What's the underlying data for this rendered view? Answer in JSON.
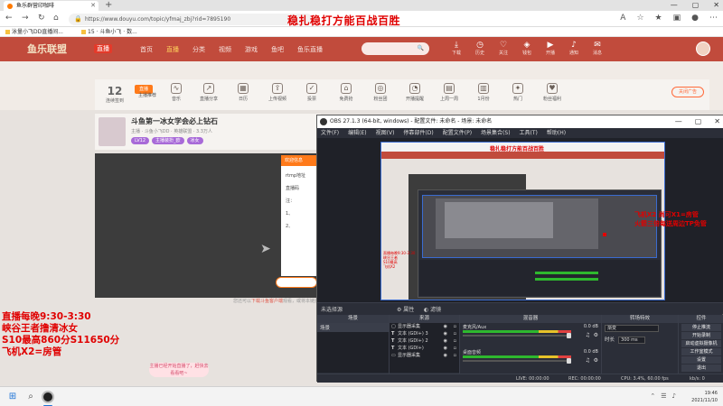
{
  "browser": {
    "tab_title": "鱼乐群营印咖啡",
    "new_tab": "+",
    "window_controls": [
      "—",
      "▢",
      "✕"
    ],
    "url": "https://www.douyu.com/topic/yfmaj_zbj?rid=7895190",
    "bookmarks": [
      "泳量小飞DD直播间...",
      "15 · 斗鱼小飞 · 数..."
    ]
  },
  "overlay_title": "稳扎稳打方能百战百胜",
  "site": {
    "logo": "鱼乐联盟",
    "logo_badge": "直播",
    "nav": [
      "首页",
      "直播",
      "分类",
      "视频",
      "游戏",
      "鱼吧",
      "鱼乐直播"
    ],
    "nav_active_index": 1,
    "header_icons": [
      "下载",
      "历史",
      "关注",
      "钱包",
      "开播",
      "通知",
      "消息"
    ],
    "func_date_num": "12",
    "func_date_label": "连续签到",
    "func_tag": "直播",
    "func_items": [
      "主播推荐",
      "音乐",
      "直播分享",
      "日历",
      "上传视频",
      "投票",
      "免费抢",
      "粉丝团",
      "开播提醒",
      "上周一周",
      "1月份",
      "热门",
      "粉丝福利"
    ],
    "func_right": "关闭广告",
    "room_title": "斗鱼第一冰女学会必上钻石",
    "room_sub": "主播 · 斗鱼小飞DD · 英雄联盟 · 3.3万人",
    "room_tags": [
      "LV12",
      "主播装扮_欧",
      "冰女"
    ],
    "popup_head": "欢迎信息",
    "popup_lines": [
      "rtmp地址",
      "直播码",
      "注：",
      "1、",
      "2、"
    ],
    "under_text_prefix": "您还可以",
    "under_text_link": "下载斗鱼客户端",
    "under_text_suffix": "观看，或将本链接...",
    "gift_bubble": "主播已经开始直播了，赶快去看看吧~"
  },
  "streamer_overlay": [
    "直播每晚9:30-3:30",
    "峡谷王者撸清冰女",
    "S10最高860分S11650分",
    "飞机X2=房管"
  ],
  "obs": {
    "title": "OBS 27.1.3 (64-bit, windows) - 配置文件: 未命名 - 场景: 未命名",
    "menu": [
      "文件(F)",
      "编辑(E)",
      "视图(V)",
      "停靠部件(D)",
      "配置文件(P)",
      "场景集合(S)",
      "工具(T)",
      "帮助(H)"
    ],
    "preview_title": "稳扎稳打方能百战百胜",
    "preview_left_red": [
      "直播每晚9:30-3:30",
      "峡谷王者",
      "S10最高",
      "飞机X2"
    ],
    "right_overlay": [
      "飞机X2  尚可X1=房管",
      "火箭三倍每送周边TP免管"
    ],
    "toolbar_nosource": "未选择源",
    "toolbar_props": "属性",
    "toolbar_filters": "滤镜",
    "dock_scenes": "场景",
    "dock_sources": "来源",
    "dock_mixer": "混音器",
    "dock_transitions": "转场特效",
    "dock_controls": "控件",
    "scene_items": [
      "场景"
    ],
    "sources": [
      {
        "icon": "▢",
        "name": "显示器采集"
      },
      {
        "icon": "T",
        "name": "文本 (GDI+) 3"
      },
      {
        "icon": "T",
        "name": "文本 (GDI+) 2"
      },
      {
        "icon": "T",
        "name": "文本 (GDI+)"
      },
      {
        "icon": "▭",
        "name": "显示器采集"
      }
    ],
    "mixer": [
      {
        "name": "麦克风/Aux",
        "db": "0.0 dB"
      },
      {
        "name": "桌面音频",
        "db": "0.0 dB"
      }
    ],
    "transition_name": "渐变",
    "duration_label": "时长",
    "duration_value": "300 ms",
    "controls": [
      "停止推流",
      "开始录制",
      "启动虚拟摄像机",
      "工作室模式",
      "设置",
      "退出"
    ],
    "status": {
      "live": "LIVE: 00:00:00",
      "rec": "REC: 00:00:00",
      "cpu": "CPU: 3.4%, 60.00 fps",
      "kbps": "kb/s: 0"
    }
  },
  "taskbar": {
    "time": "19:46",
    "date": "2021/11/10"
  }
}
